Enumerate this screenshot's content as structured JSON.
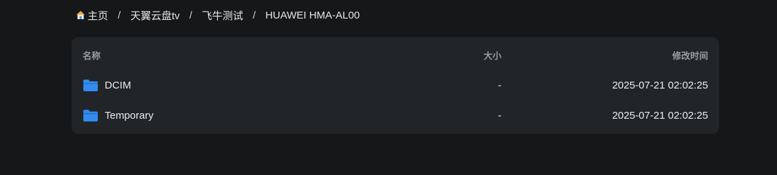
{
  "breadcrumb": {
    "items": [
      {
        "label": "主页",
        "icon": "home-icon"
      },
      {
        "label": "天翼云盘tv"
      },
      {
        "label": "飞牛测试"
      },
      {
        "label": "HUAWEI HMA-AL00"
      }
    ],
    "separator": "/"
  },
  "table": {
    "headers": {
      "name": "名称",
      "size": "大小",
      "modified": "修改时间"
    },
    "rows": [
      {
        "name": "DCIM",
        "size": "-",
        "modified": "2025-07-21 02:02:25",
        "icon": "folder-icon"
      },
      {
        "name": "Temporary",
        "size": "-",
        "modified": "2025-07-21 02:02:25",
        "icon": "folder-icon"
      }
    ]
  },
  "colors": {
    "background": "#161719",
    "panel": "#222527",
    "folder": "#2f8cf0",
    "header_text": "#9a9d9f"
  }
}
